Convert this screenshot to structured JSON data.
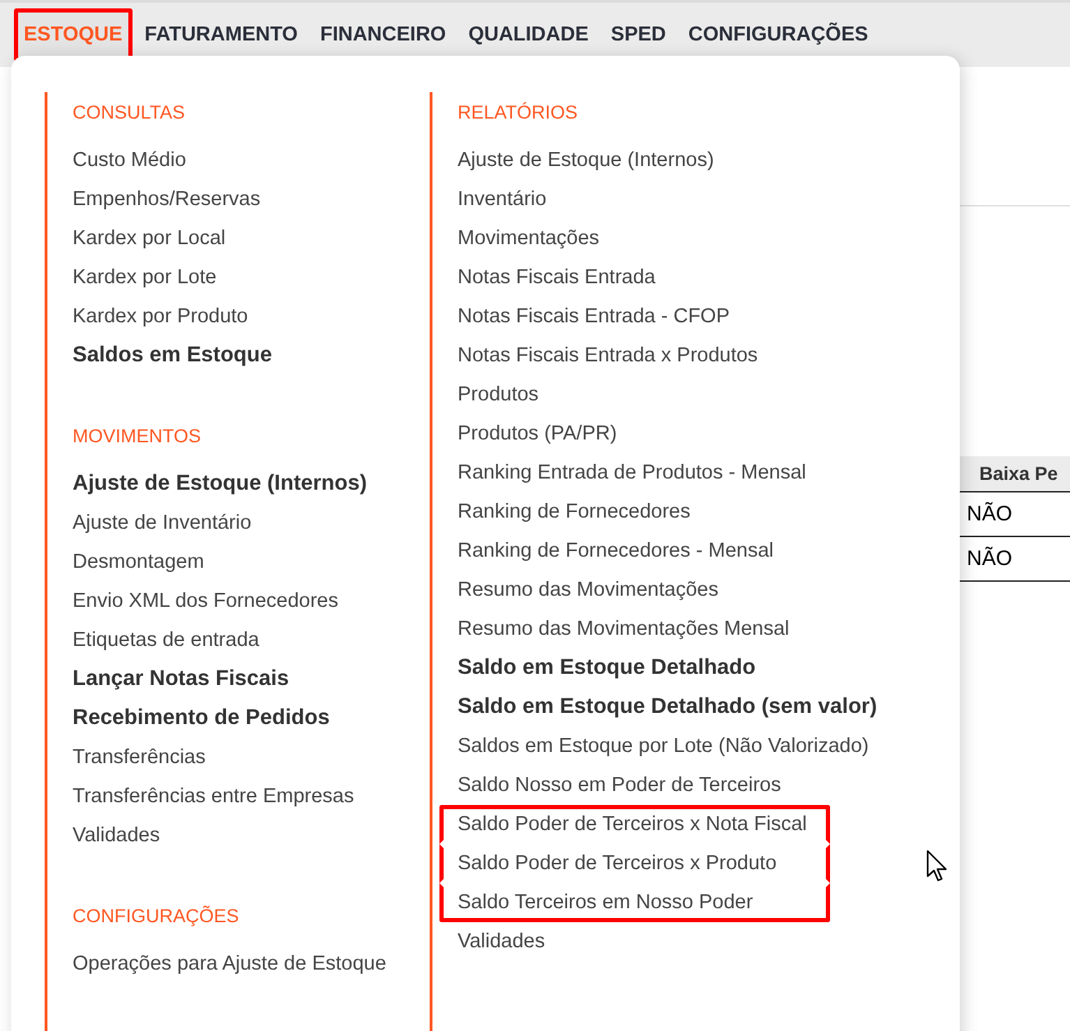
{
  "nav": [
    {
      "label": "ESTOQUE",
      "selected": true,
      "highlighted": true
    },
    {
      "label": "FATURAMENTO",
      "selected": false,
      "highlighted": false
    },
    {
      "label": "FINANCEIRO",
      "selected": false,
      "highlighted": false
    },
    {
      "label": "QUALIDADE",
      "selected": false,
      "highlighted": false
    },
    {
      "label": "SPED",
      "selected": false,
      "highlighted": false
    },
    {
      "label": "CONFIGURAÇÕES",
      "selected": false,
      "highlighted": false
    }
  ],
  "background_table": {
    "header": "Baixa Pe",
    "rows": [
      "NÃO",
      "NÃO"
    ]
  },
  "menu": {
    "columns": [
      {
        "sections": [
          {
            "title": "CONSULTAS",
            "items": [
              {
                "label": "Custo Médio",
                "bold": false,
                "highlighted": false
              },
              {
                "label": "Empenhos/Reservas",
                "bold": false,
                "highlighted": false
              },
              {
                "label": "Kardex por Local",
                "bold": false,
                "highlighted": false
              },
              {
                "label": "Kardex por Lote",
                "bold": false,
                "highlighted": false
              },
              {
                "label": "Kardex por Produto",
                "bold": false,
                "highlighted": false
              },
              {
                "label": "Saldos em Estoque",
                "bold": true,
                "highlighted": false
              }
            ]
          },
          {
            "title": "MOVIMENTOS",
            "items": [
              {
                "label": "Ajuste de Estoque (Internos)",
                "bold": true,
                "highlighted": false
              },
              {
                "label": "Ajuste de Inventário",
                "bold": false,
                "highlighted": false
              },
              {
                "label": "Desmontagem",
                "bold": false,
                "highlighted": false
              },
              {
                "label": "Envio XML dos Fornecedores",
                "bold": false,
                "highlighted": false
              },
              {
                "label": "Etiquetas de entrada",
                "bold": false,
                "highlighted": false
              },
              {
                "label": "Lançar Notas Fiscais",
                "bold": true,
                "highlighted": false
              },
              {
                "label": "Recebimento de Pedidos",
                "bold": true,
                "highlighted": false
              },
              {
                "label": "Transferências",
                "bold": false,
                "highlighted": false
              },
              {
                "label": "Transferências entre Empresas",
                "bold": false,
                "highlighted": false
              },
              {
                "label": "Validades",
                "bold": false,
                "highlighted": false
              }
            ]
          },
          {
            "title": "CONFIGURAÇÕES",
            "items": [
              {
                "label": "Operações para Ajuste de Estoque",
                "bold": false,
                "highlighted": false
              }
            ]
          }
        ]
      },
      {
        "sections": [
          {
            "title": "RELATÓRIOS",
            "items": [
              {
                "label": "Ajuste de Estoque (Internos)",
                "bold": false,
                "highlighted": false
              },
              {
                "label": "Inventário",
                "bold": false,
                "highlighted": false
              },
              {
                "label": "Movimentações",
                "bold": false,
                "highlighted": false
              },
              {
                "label": "Notas Fiscais Entrada",
                "bold": false,
                "highlighted": false
              },
              {
                "label": "Notas Fiscais Entrada - CFOP",
                "bold": false,
                "highlighted": false
              },
              {
                "label": "Notas Fiscais Entrada x Produtos",
                "bold": false,
                "highlighted": false
              },
              {
                "label": "Produtos",
                "bold": false,
                "highlighted": false
              },
              {
                "label": "Produtos (PA/PR)",
                "bold": false,
                "highlighted": false
              },
              {
                "label": "Ranking Entrada de Produtos - Mensal",
                "bold": false,
                "highlighted": false
              },
              {
                "label": "Ranking de Fornecedores",
                "bold": false,
                "highlighted": false
              },
              {
                "label": "Ranking de Fornecedores - Mensal",
                "bold": false,
                "highlighted": false
              },
              {
                "label": "Resumo das Movimentações",
                "bold": false,
                "highlighted": false
              },
              {
                "label": "Resumo das Movimentações Mensal",
                "bold": false,
                "highlighted": false
              },
              {
                "label": "Saldo em Estoque Detalhado",
                "bold": true,
                "highlighted": false
              },
              {
                "label": "Saldo em Estoque Detalhado (sem valor)",
                "bold": true,
                "highlighted": false
              },
              {
                "label": "Saldos em Estoque por Lote (Não Valorizado)",
                "bold": false,
                "highlighted": false
              },
              {
                "label": "Saldo Nosso em Poder de Terceiros",
                "bold": false,
                "highlighted": false
              },
              {
                "label": "Saldo Poder de Terceiros x Nota Fiscal",
                "bold": false,
                "highlighted": true
              },
              {
                "label": "Saldo Poder de Terceiros x Produto",
                "bold": false,
                "highlighted": true
              },
              {
                "label": "Saldo Terceiros em Nosso Poder",
                "bold": false,
                "highlighted": true
              },
              {
                "label": "Validades",
                "bold": false,
                "highlighted": false
              }
            ]
          }
        ]
      }
    ]
  }
}
